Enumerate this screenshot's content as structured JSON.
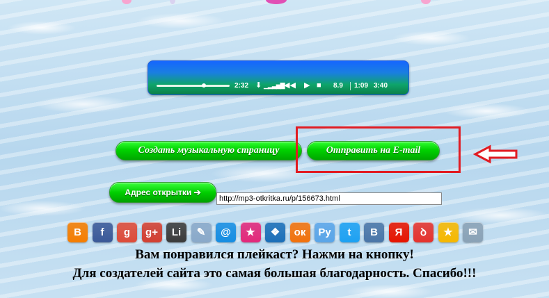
{
  "player": {
    "time_left": "2:32",
    "volume": "8.9",
    "time_current": "1:09",
    "time_total": "3:40",
    "progress_fraction": 0.65
  },
  "buttons": {
    "create_page": "Создать музыкальную страницу",
    "send_email": "Отправить на E-mail",
    "card_address": "Адрес открытки ➔"
  },
  "url_field": {
    "value": "http://mp3-otkritka.ru/p/156673.html"
  },
  "share_icons": [
    {
      "name": "blogger-icon",
      "glyph": "B",
      "color": "#f57d00"
    },
    {
      "name": "facebook-icon",
      "glyph": "f",
      "color": "#3b5998"
    },
    {
      "name": "google-icon",
      "glyph": "g",
      "color": "#dd4b39"
    },
    {
      "name": "google-plus-icon",
      "glyph": "g+",
      "color": "#d23f31"
    },
    {
      "name": "liveinternet-icon",
      "glyph": "Li",
      "color": "#3b3b3b"
    },
    {
      "name": "livejournal-icon",
      "glyph": "✎",
      "color": "#8aa9c9"
    },
    {
      "name": "mail-ru-icon",
      "glyph": "@",
      "color": "#168de2"
    },
    {
      "name": "favorites-icon",
      "glyph": "★",
      "color": "#e2287a"
    },
    {
      "name": "myworld-icon",
      "glyph": "❖",
      "color": "#1c6fb8"
    },
    {
      "name": "odnoklassniki-icon",
      "glyph": "ок",
      "color": "#f2720c"
    },
    {
      "name": "yaru-icon",
      "glyph": "Ру",
      "color": "#5aa5e8"
    },
    {
      "name": "twitter-icon",
      "glyph": "t",
      "color": "#1da1f2"
    },
    {
      "name": "vkontakte-icon",
      "glyph": "B",
      "color": "#4a76a8"
    },
    {
      "name": "yandex-icon",
      "glyph": "Я",
      "color": "#e61400"
    },
    {
      "name": "surfingbird-icon",
      "glyph": "ꝺ",
      "color": "#e5322d"
    },
    {
      "name": "bookmark-icon",
      "glyph": "★",
      "color": "#f6b800"
    },
    {
      "name": "email-icon",
      "glyph": "✉",
      "color": "#8aa2b6"
    }
  ],
  "message": {
    "line1": "Вам понравился плейкаст? Нажми на кнопку!",
    "line2": "Для создателей сайта это самая большая благодарность. Спасибо!!!"
  },
  "colors": {
    "highlight_red": "#e11b22",
    "button_green": "#00d200"
  }
}
